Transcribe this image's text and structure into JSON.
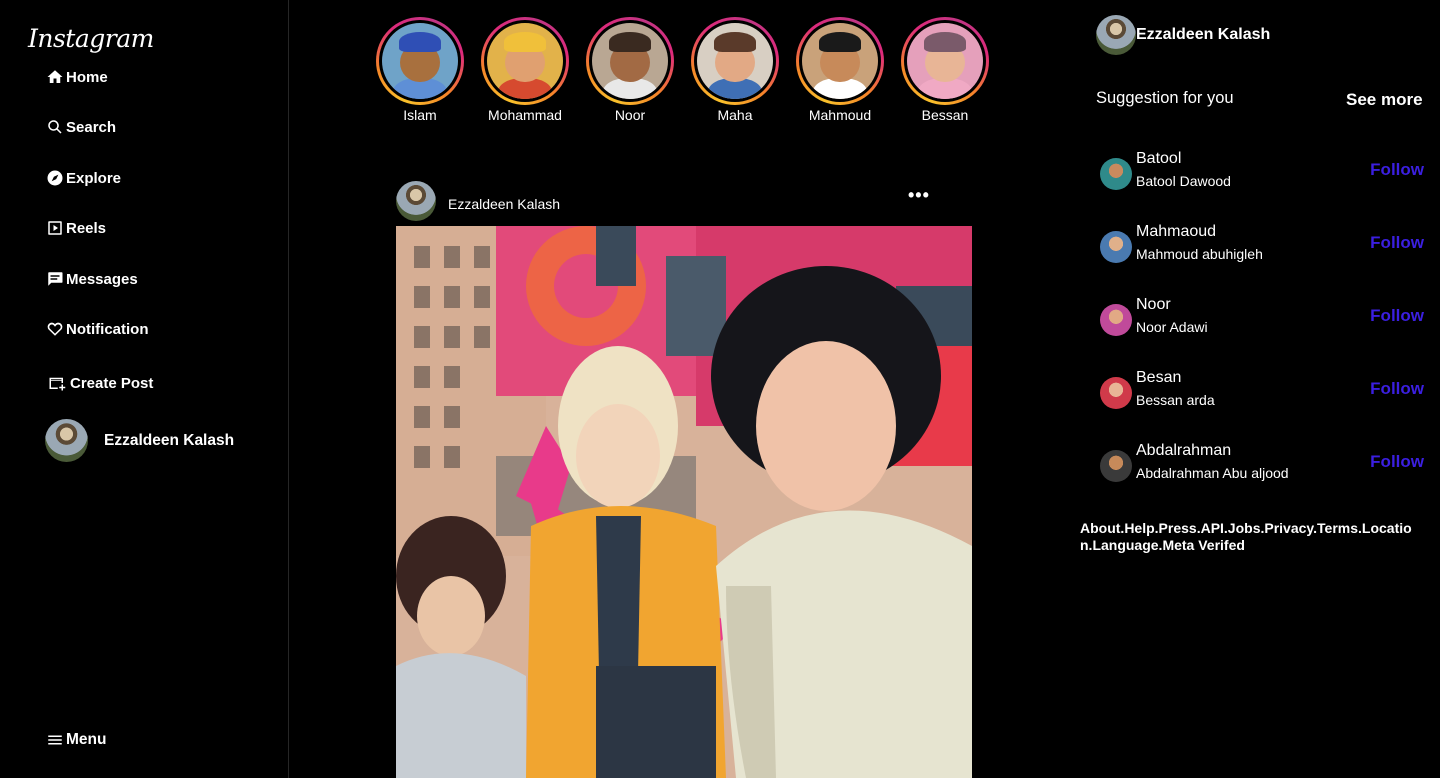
{
  "app": {
    "logo_text": "Instagram"
  },
  "sidebar": {
    "items": [
      {
        "label": "Home",
        "icon": "home-icon"
      },
      {
        "label": "Search",
        "icon": "search-icon"
      },
      {
        "label": "Explore",
        "icon": "compass-icon"
      },
      {
        "label": "Reels",
        "icon": "reels-icon"
      },
      {
        "label": "Messages",
        "icon": "chat-icon"
      },
      {
        "label": "Notification",
        "icon": "heart-icon"
      },
      {
        "label": "Create Post",
        "icon": "create-post-icon"
      }
    ],
    "profile_name": "Ezzaldeen Kalash",
    "menu_label": "Menu"
  },
  "stories": [
    {
      "name": "Islam"
    },
    {
      "name": "Mohammad"
    },
    {
      "name": "Noor"
    },
    {
      "name": "Maha"
    },
    {
      "name": "Mahmoud"
    },
    {
      "name": "Bessan"
    }
  ],
  "post": {
    "author": "Ezzaldeen Kalash",
    "more_icon": "more-horizontal-icon"
  },
  "right": {
    "user_name": "Ezzaldeen Kalash",
    "suggestion_title": "Suggestion for you",
    "see_more": "See more",
    "suggestions": [
      {
        "name": "Batool",
        "full_name": "Batool Dawood",
        "follow": "Follow"
      },
      {
        "name": "Mahmaoud",
        "full_name": "Mahmoud abuhigleh",
        "follow": "Follow"
      },
      {
        "name": "Noor",
        "full_name": "Noor Adawi",
        "follow": "Follow"
      },
      {
        "name": "Besan",
        "full_name": "Bessan arda",
        "follow": "Follow"
      },
      {
        "name": "Abdalrahman",
        "full_name": "Abdalrahman Abu aljood",
        "follow": "Follow"
      }
    ],
    "footer": "About.Help.Press.API.Jobs.Privacy.Terms.Location.Language.Meta Verifed"
  },
  "colors": {
    "follow": "#3b1fe0",
    "background": "#000000",
    "story_ring": "#dd2a7b"
  }
}
